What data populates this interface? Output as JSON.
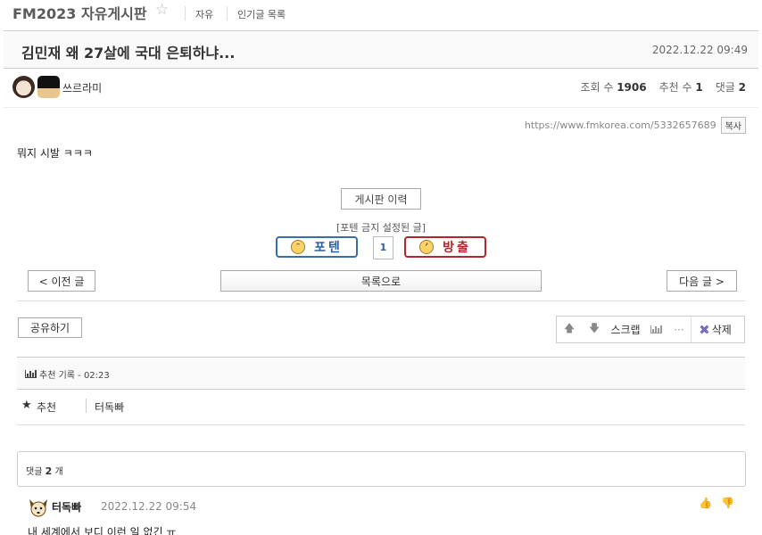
{
  "header": {
    "board_title": "FM2023 자유게시판",
    "links": [
      "자유",
      "인기글 목록"
    ]
  },
  "post": {
    "title": "김민재 왜 27살에 국대 은퇴하냐...",
    "date": "2022.12.22 09:49",
    "author": "쓰르라미",
    "stats": {
      "views_label": "조회 수",
      "views": "1906",
      "recommend_label": "추천 수",
      "recommends": "1",
      "comments_label": "댓글",
      "comments": "2"
    },
    "url": "https://www.fmkorea.com/5332657689",
    "copy_label": "복사",
    "body": "뭐지 시발 ㅋㅋㅋ"
  },
  "actions": {
    "history_label": "게시판 이력",
    "forbidden_label": "[포텐 금지 설정된 글]",
    "poten_label": "포텐",
    "poten_count": "1",
    "ban_label": "방출",
    "prev_label": "< 이전 글",
    "list_label": "목록으로",
    "next_label": "다음 글 >",
    "share_label": "공유하기",
    "scrap_label": "스크랩",
    "delete_label": "삭제"
  },
  "vote_log": {
    "label": "추천 기록 - 02:23"
  },
  "recommenders": {
    "label": "추천",
    "users": [
      "터독빠"
    ]
  },
  "comments": {
    "label": "댓글",
    "count": "2",
    "unit": "개",
    "items": [
      {
        "author": "터독빠",
        "date": "2022.12.22 09:54",
        "text": "내 세계에서 보디 이런 일 없긴 ㅠ"
      }
    ]
  },
  "icons": {
    "star": "star-icon",
    "up": "arrow-up-icon",
    "down": "arrow-down-icon",
    "graph": "bar-chart-icon",
    "more": "more-icon",
    "delete": "x-icon",
    "like": "thumbs-up-icon",
    "dislike": "thumbs-down-icon"
  },
  "colors": {
    "poten_blue": "#3a6ea8",
    "ban_red": "#b3262b",
    "delete_purple": "#7b6cc1"
  }
}
